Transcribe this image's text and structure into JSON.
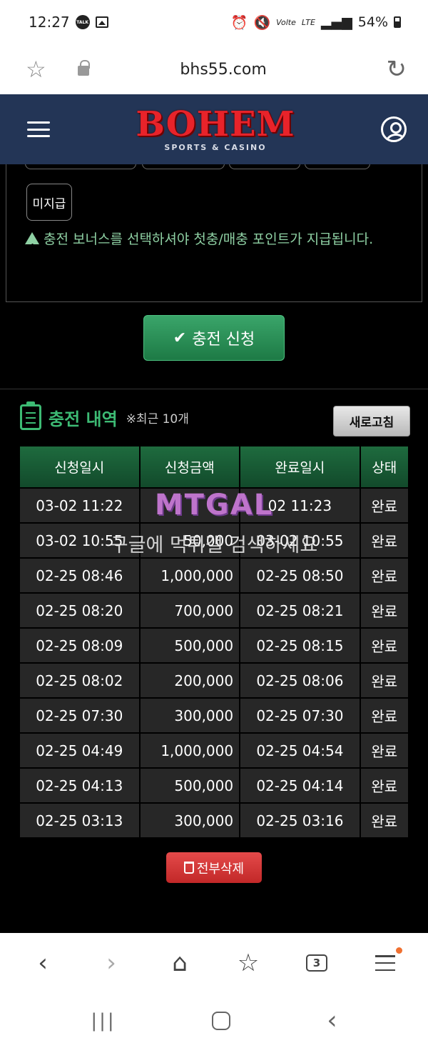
{
  "status_bar": {
    "time": "12:27",
    "kakao_badge": "TALK",
    "network": "LTE",
    "volte": "Volte",
    "battery": "54%"
  },
  "browser": {
    "url": "bhs55.com",
    "tab_count": "3"
  },
  "site": {
    "logo_main": "BOHEM",
    "logo_sub": "SPORTS & CASINO"
  },
  "bonus": {
    "option_label": "미지급",
    "warning": "충전 보너스를 선택하셔야 첫충/매충 포인트가 지급됩니다."
  },
  "apply_button": "충전 신청",
  "history": {
    "title": "충전 내역",
    "note": "※최근 10개",
    "refresh_label": "새로고침",
    "columns": [
      "신청일시",
      "신청금액",
      "완료일시",
      "상태"
    ],
    "rows": [
      {
        "requested": "03-02 11:22",
        "amount": "",
        "completed": "02 11:23",
        "status": "완료"
      },
      {
        "requested": "03-02 10:55",
        "amount": "50,000",
        "completed": "03-02 10:55",
        "status": "완료"
      },
      {
        "requested": "02-25 08:46",
        "amount": "1,000,000",
        "completed": "02-25 08:50",
        "status": "완료"
      },
      {
        "requested": "02-25 08:20",
        "amount": "700,000",
        "completed": "02-25 08:21",
        "status": "완료"
      },
      {
        "requested": "02-25 08:09",
        "amount": "500,000",
        "completed": "02-25 08:15",
        "status": "완료"
      },
      {
        "requested": "02-25 08:02",
        "amount": "200,000",
        "completed": "02-25 08:06",
        "status": "완료"
      },
      {
        "requested": "02-25 07:30",
        "amount": "300,000",
        "completed": "02-25 07:30",
        "status": "완료"
      },
      {
        "requested": "02-25 04:49",
        "amount": "1,000,000",
        "completed": "02-25 04:54",
        "status": "완료"
      },
      {
        "requested": "02-25 04:13",
        "amount": "500,000",
        "completed": "02-25 04:14",
        "status": "완료"
      },
      {
        "requested": "02-25 03:13",
        "amount": "300,000",
        "completed": "02-25 03:16",
        "status": "완료"
      }
    ],
    "delete_all_label": "전부삭제"
  },
  "watermark": {
    "logo": "MTGAL",
    "text": "구글에 먹튀갤 검색하세요"
  },
  "colors": {
    "header_bg": "#233556",
    "logo_red": "#e8232a",
    "accent_green": "#3dbb74",
    "warning_green": "#8fd1a4",
    "delete_red": "#d23636"
  }
}
